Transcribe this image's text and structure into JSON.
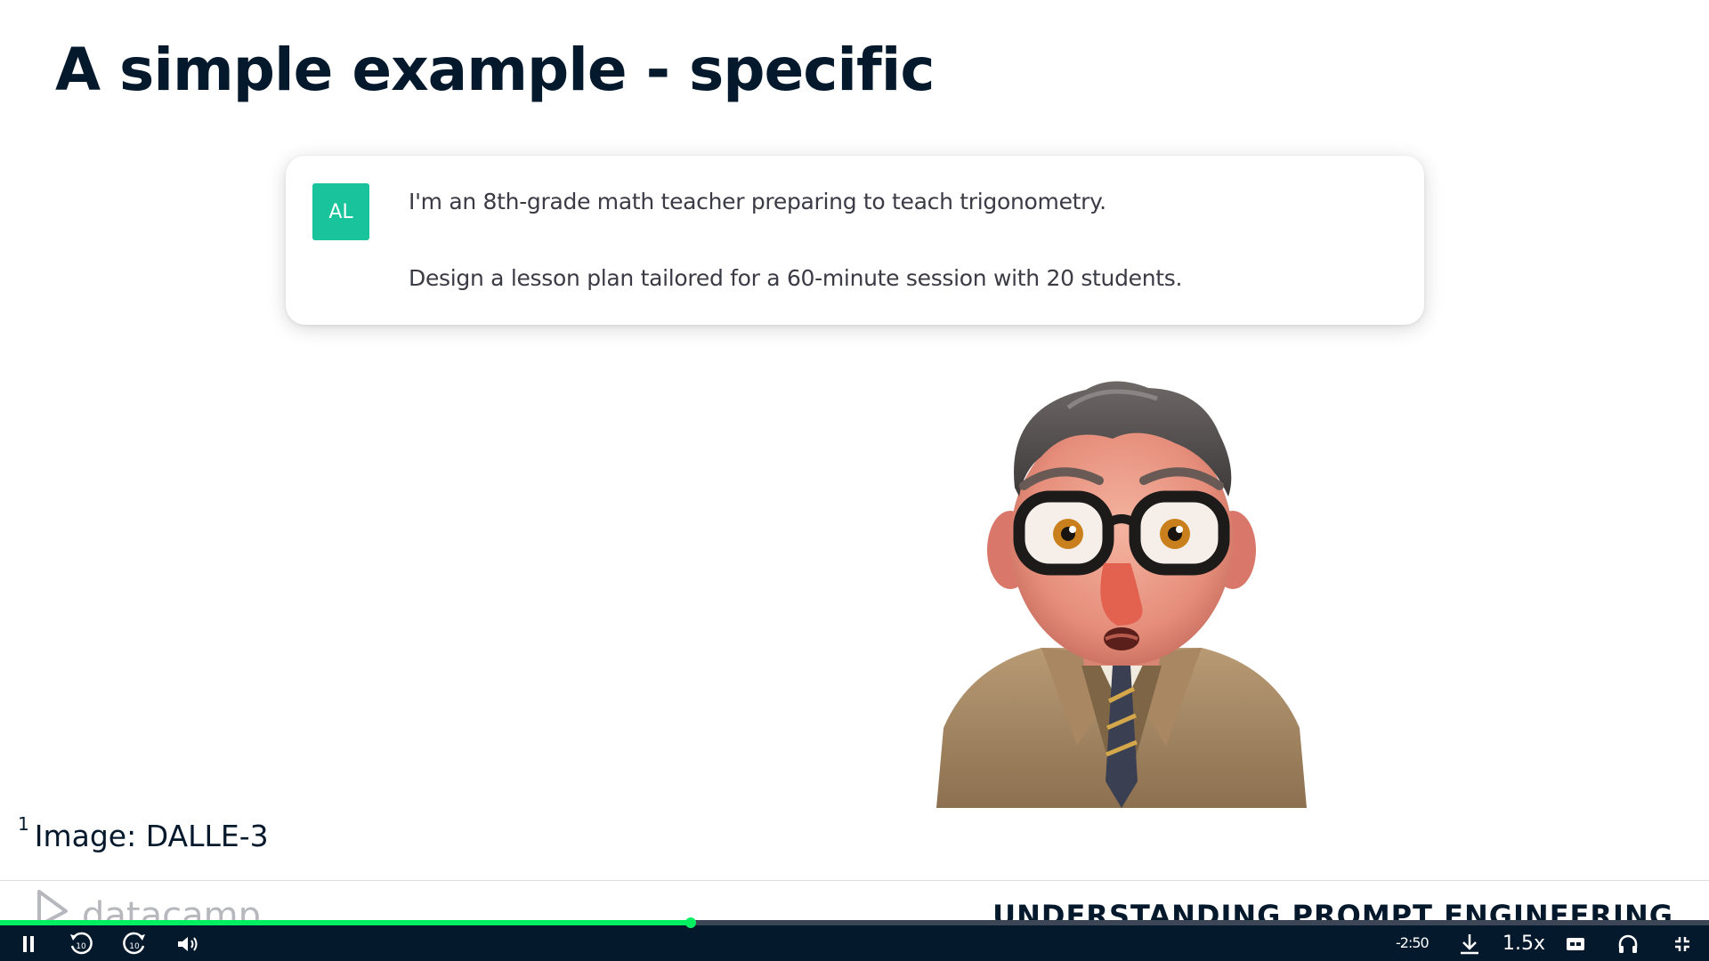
{
  "slide": {
    "title": "A simple example - specific",
    "chat": {
      "avatar_initials": "AL",
      "avatar_color": "#19c39b",
      "message_lines": [
        "I'm an 8th-grade math teacher preparing to teach trigonometry.",
        "Design a lesson plan tailored for a 60-minute session with 20 students."
      ]
    },
    "footnote": {
      "marker": "1",
      "text": "Image: DALLE-3"
    },
    "brand": {
      "name": "datacamp"
    },
    "course_title": "UNDERSTANDING PROMPT ENGINEERING"
  },
  "player": {
    "progress_fraction": 0.404,
    "time_remaining": "-2:50",
    "speed": "1.5x",
    "progress_color": "#03ef62",
    "bar_color": "#05192d",
    "controls": [
      "pause-icon",
      "rewind-10-icon",
      "forward-10-icon",
      "volume-icon",
      "download-icon",
      "captions-icon",
      "audio-description-icon",
      "exit-fullscreen-icon"
    ]
  }
}
